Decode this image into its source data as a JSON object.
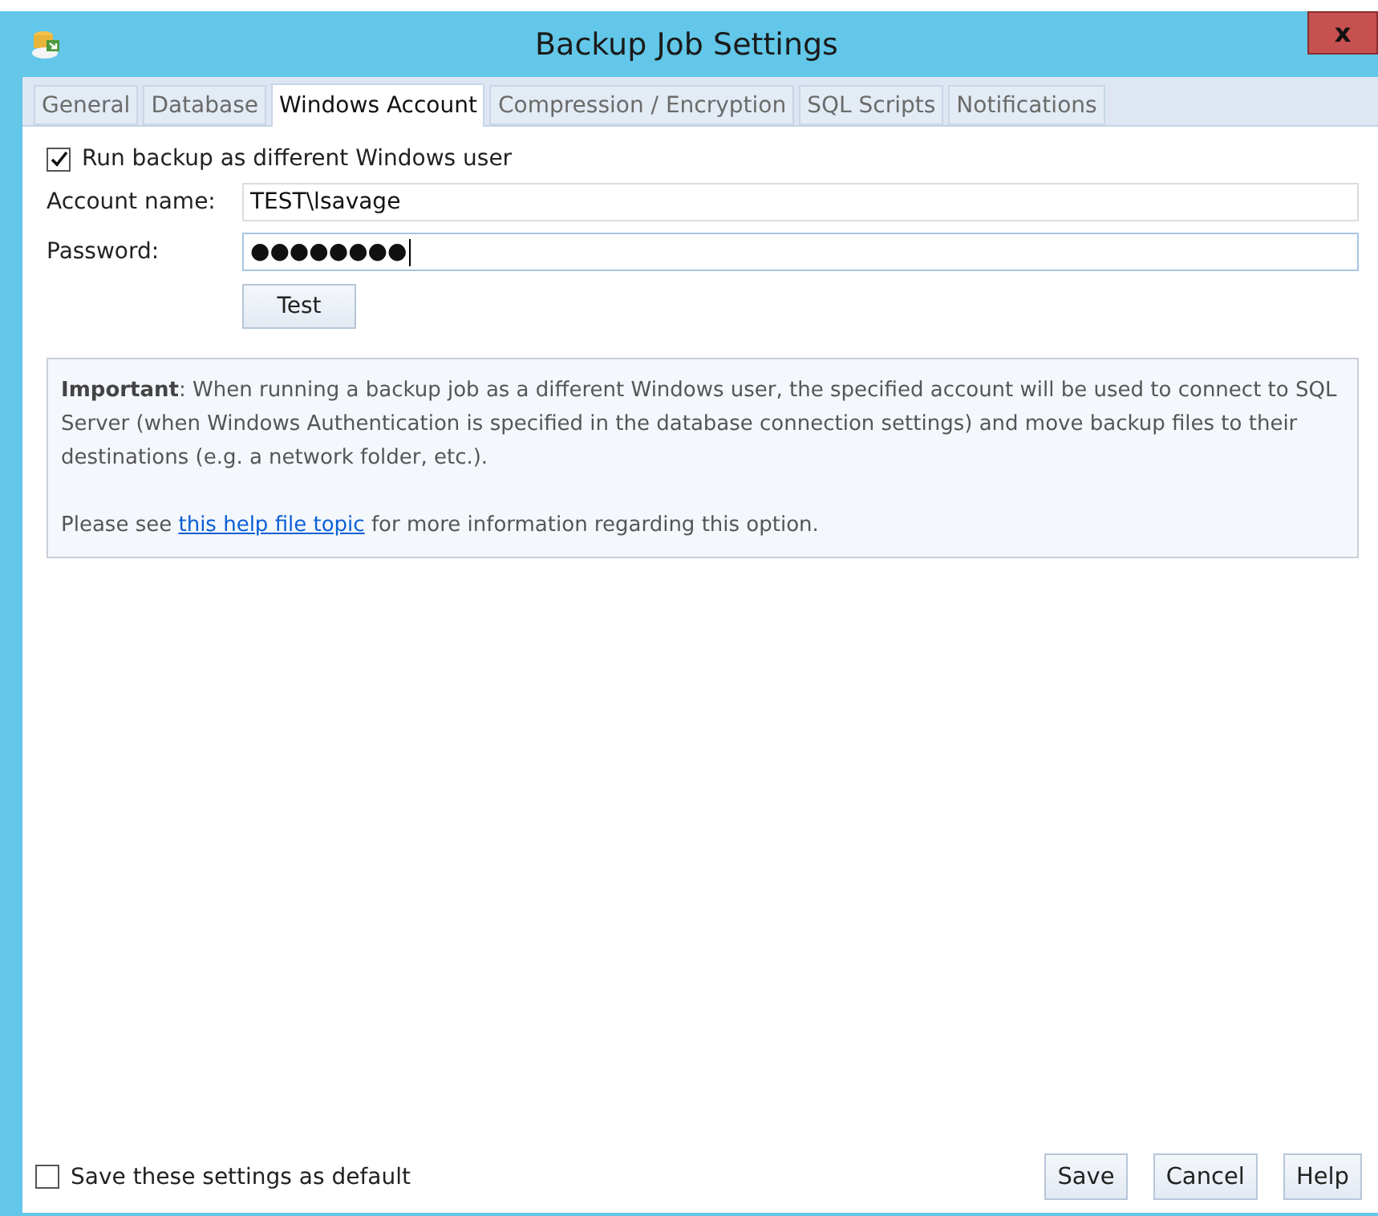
{
  "window": {
    "title": "Backup Job Settings",
    "close": "x"
  },
  "tabs": [
    {
      "label": "General",
      "selected": false
    },
    {
      "label": "Database",
      "selected": false
    },
    {
      "label": "Windows Account",
      "selected": true
    },
    {
      "label": "Compression / Encryption",
      "selected": false
    },
    {
      "label": "SQL Scripts",
      "selected": false
    },
    {
      "label": "Notifications",
      "selected": false
    }
  ],
  "run_as": {
    "label": "Run backup as different Windows user",
    "checked": true
  },
  "fields": [
    {
      "label": "Account name:",
      "value": "TEST\\lsavage",
      "focused": false
    },
    {
      "label": "Password:",
      "value": "●●●●●●●●",
      "focused": true
    }
  ],
  "test_button": "Test",
  "info": {
    "paragraph": "**Important**: When running a backup job as a different Windows user, the specified account will be used to connect to SQL Server (when Windows Authentication is specified in the database connection settings) and move backup files to their destinations (e.g. a network folder, etc.).",
    "help_before": "Please see ",
    "help_link": "this help file topic",
    "help_after": " for more information regarding this option."
  },
  "default_checkbox": {
    "label": "Save these settings as default",
    "checked": false
  },
  "buttons": [
    "Save",
    "Cancel",
    "Help"
  ]
}
